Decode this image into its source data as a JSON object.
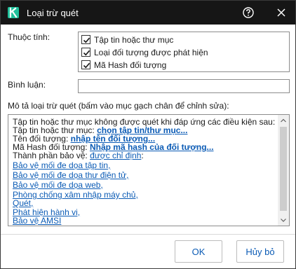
{
  "window": {
    "title": "Loại trừ quét",
    "logo_letter": "K",
    "brand_color": "#1fbf9a",
    "titlebar_color": "#161616"
  },
  "properties": {
    "label": "Thuộc tính:",
    "options": [
      {
        "label": "Tập tin hoặc thư mục",
        "checked": true
      },
      {
        "label": "Loại đối tượng được phát hiện",
        "checked": true
      },
      {
        "label": "Mã Hash đối tượng",
        "checked": true
      }
    ]
  },
  "comment": {
    "label": "Bình luận:",
    "value": ""
  },
  "description": {
    "label": "Mô tả loại trừ quét (bấm vào mục gạch chân để chỉnh sửa):",
    "lines": {
      "intro": "Tập tin hoặc thư mục không được quét khi đáp ứng các điều kiện sau:",
      "file_prefix": "Tập tin hoặc thư mục: ",
      "file_link": "chọn tập tin/thư mục...",
      "object_prefix": "Tên đối tượng: ",
      "object_link": "nhập tên đối tượng...",
      "hash_prefix": "Mã Hash đối tượng: ",
      "hash_link": "Nhập mã hash của đối tượng...",
      "component_prefix": "Thành phần bảo vệ: ",
      "component_link": "được chỉ định",
      "component_suffix": ":"
    },
    "components": [
      "Bảo vệ mối đe dọa tập tin,",
      "Bảo vệ mối đe dọa thư điện tử,",
      "Bảo vệ mối đe dọa web,",
      "Phòng chống xâm nhập máy chủ,",
      "Quét,",
      "Phát hiện hành vi,",
      "Bảo vệ AMSI"
    ],
    "link_color": "#0b5bb5"
  },
  "buttons": {
    "ok": "OK",
    "cancel": "Hủy bỏ"
  },
  "icons": {
    "help": "help-icon",
    "close": "close-icon",
    "check": "check-icon"
  }
}
